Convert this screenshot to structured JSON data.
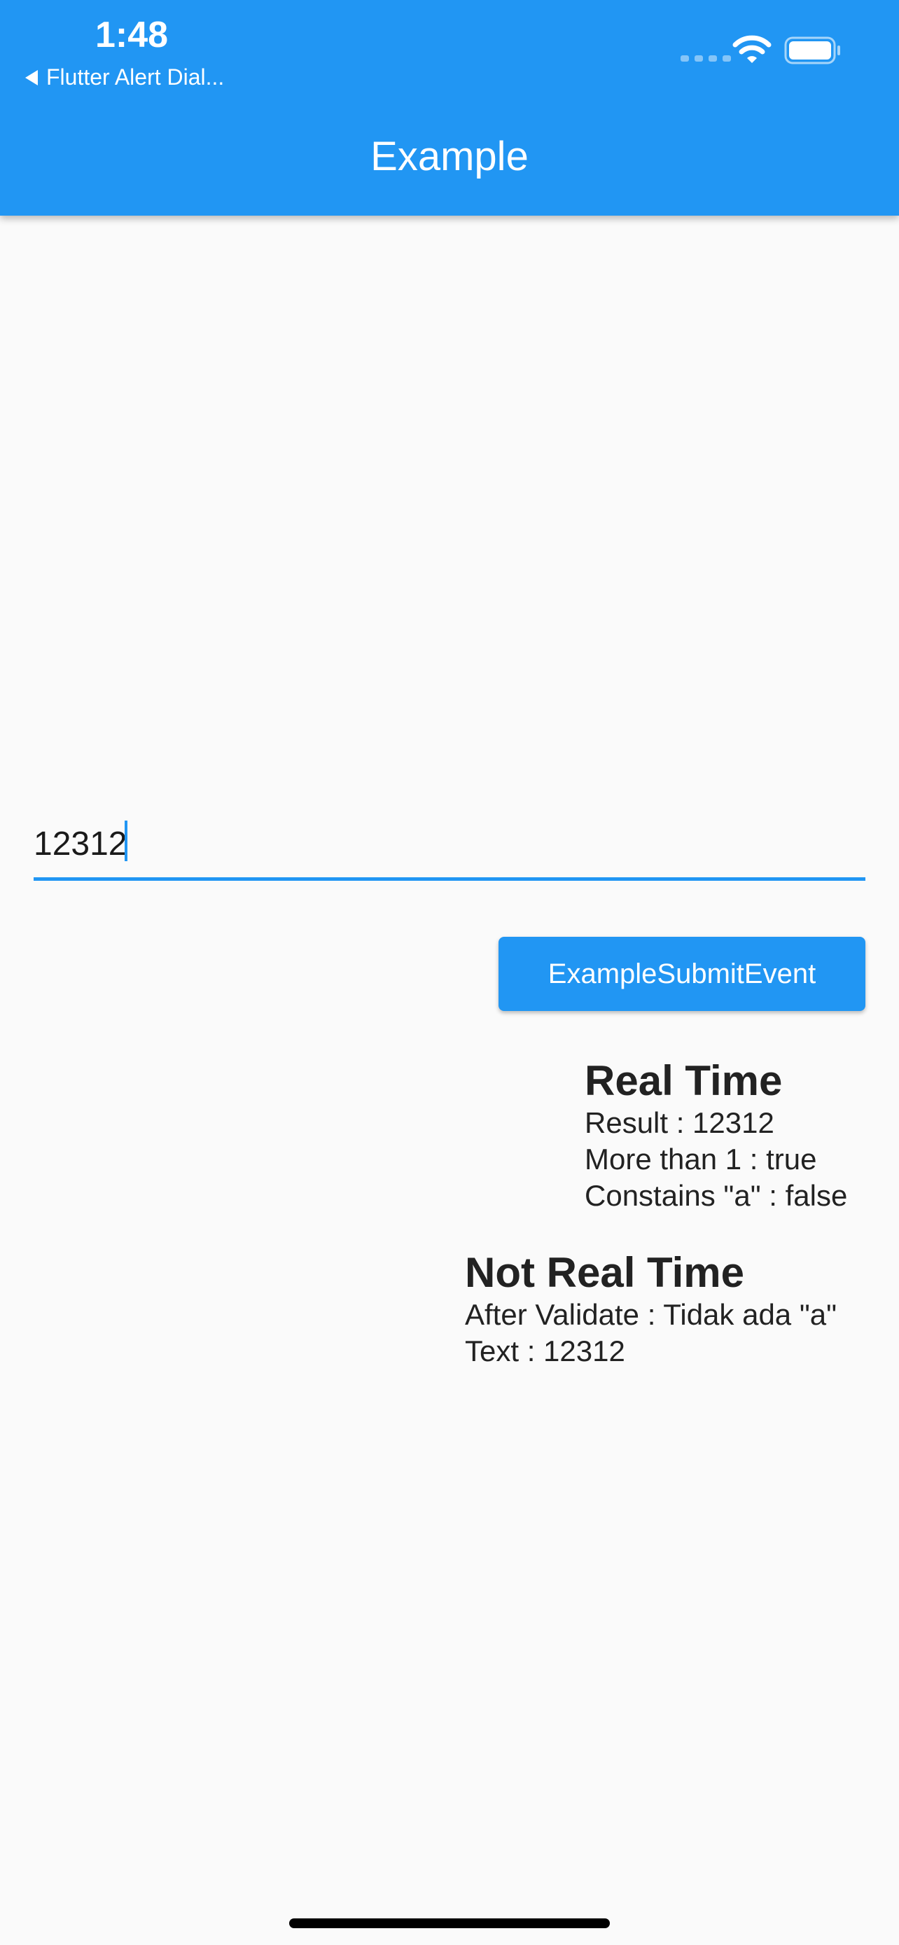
{
  "status_bar": {
    "time": "1:48",
    "back_app_label": "Flutter Alert Dial...",
    "icons": [
      "signal-icon",
      "wifi-icon",
      "battery-icon"
    ]
  },
  "app_bar": {
    "title": "Example",
    "color": "#2196f3"
  },
  "form": {
    "input_value": "12312",
    "submit_label": "ExampleSubmitEvent"
  },
  "real_time": {
    "heading": "Real Time",
    "lines": [
      "Result : 12312",
      "More than 1 : true",
      "Constains \"a\" : false"
    ]
  },
  "not_real_time": {
    "heading": "Not Real Time",
    "lines": [
      "After Validate : Tidak ada \"a\"",
      "Text : 12312"
    ]
  }
}
